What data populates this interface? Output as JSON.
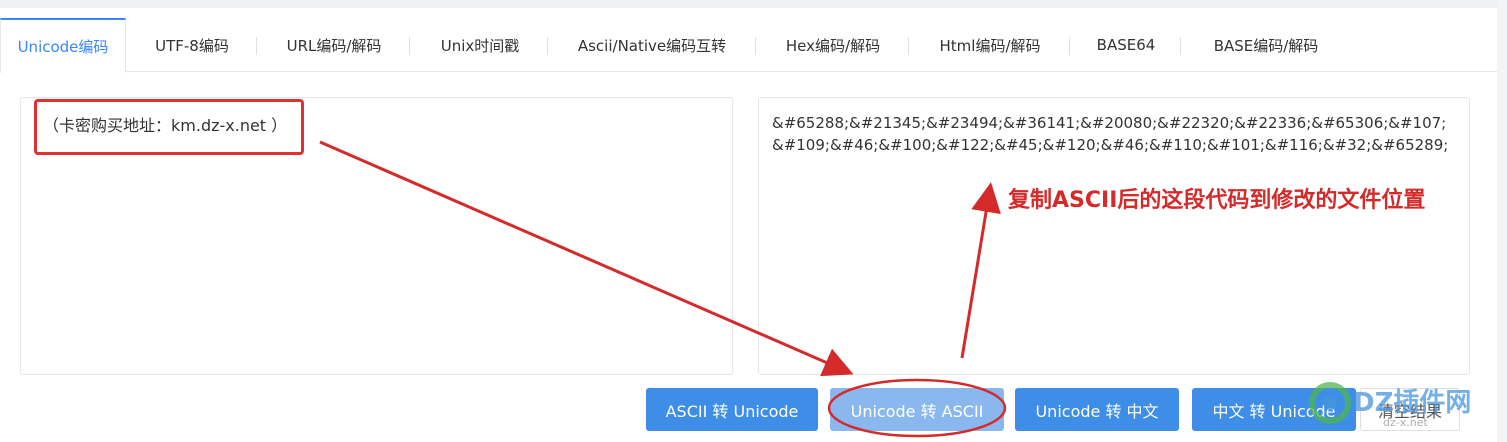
{
  "tabs": [
    {
      "label": "Unicode编码",
      "active": true
    },
    {
      "label": "UTF-8编码"
    },
    {
      "label": "URL编码/解码"
    },
    {
      "label": "Unix时间戳"
    },
    {
      "label": "Ascii/Native编码互转"
    },
    {
      "label": "Hex编码/解码"
    },
    {
      "label": "Html编码/解码"
    },
    {
      "label": "BASE64"
    },
    {
      "label": "BASE编码/解码"
    }
  ],
  "input": {
    "value": "（卡密购买地址：km.dz-x.net ）"
  },
  "output": {
    "value": "&#65288;&#21345;&#23494;&#36141;&#20080;&#22320;&#22336;&#65306;&#107;&#109;&#46;&#100;&#122;&#45;&#120;&#46;&#110;&#101;&#116;&#32;&#65289;"
  },
  "annotation": {
    "text": "复制ASCII后的这段代码到修改的文件位置",
    "color": "#d42a2a"
  },
  "buttons": {
    "ascii_to_unicode": "ASCII 转 Unicode",
    "unicode_to_ascii": "Unicode 转 ASCII",
    "unicode_to_chinese": "Unicode 转 中文",
    "chinese_to_unicode": "中文 转 Unicode",
    "clear_result": "清空结果"
  },
  "watermark": {
    "text": "DZ插件网",
    "sub": "dz-x.net"
  },
  "colors": {
    "accent": "#3e8ee7",
    "active_tab": "#3a86ff",
    "annotation_red": "#e03030"
  }
}
